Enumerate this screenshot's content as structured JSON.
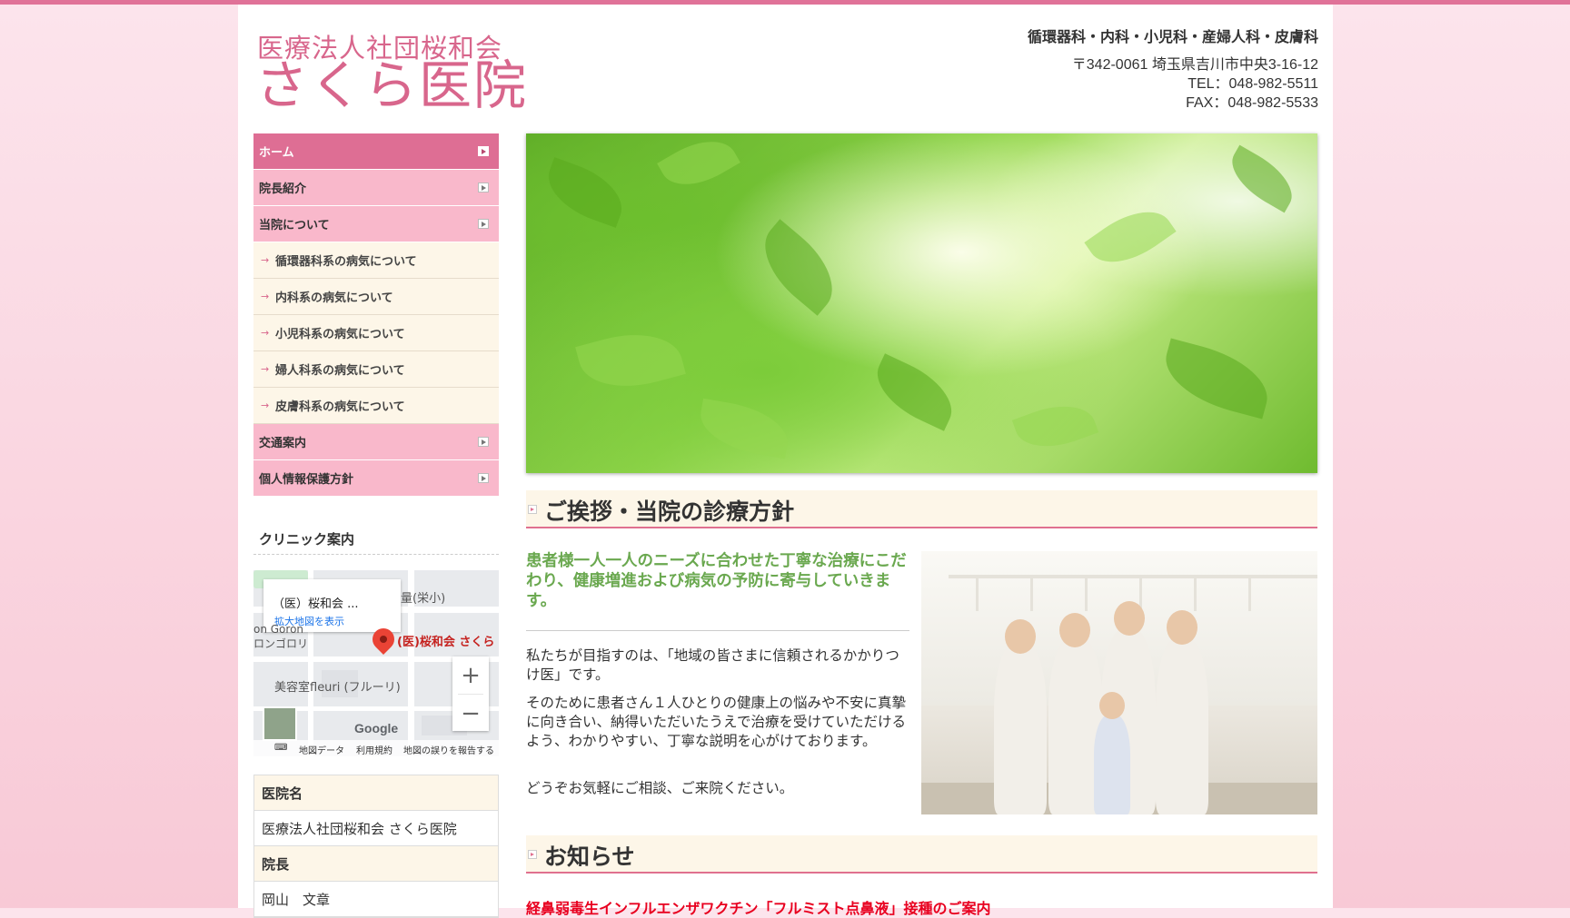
{
  "header": {
    "org_name": "医療法人社団桜和会",
    "clinic_name": "さくら医院",
    "specialties": "循環器科・内科・小児科・産婦人科・皮膚科",
    "address": "〒342-0061 埼玉県吉川市中央3-16-12",
    "tel": "TEL：048-982-5511",
    "fax": "FAX：048-982-5533"
  },
  "nav": {
    "items": [
      {
        "label": "ホーム"
      },
      {
        "label": "院長紹介"
      },
      {
        "label": "当院について"
      }
    ],
    "sub_items": [
      {
        "label": "循環器科系の病気について"
      },
      {
        "label": "内科系の病気について"
      },
      {
        "label": "小児科系の病気について"
      },
      {
        "label": "婦人科系の病気について"
      },
      {
        "label": "皮膚科系の病気について"
      }
    ],
    "items_after": [
      {
        "label": "交通案内"
      },
      {
        "label": "個人情報保護方針"
      }
    ]
  },
  "clinic_section": {
    "heading": "クリニック案内"
  },
  "map": {
    "card_title": "（医）桜和会 ...",
    "card_link": "拡大地図を表示",
    "label_school": "量(栄小)",
    "label_place1": "on Goron",
    "label_place2": "ロンゴロリ",
    "label_clinic": "(医)桜和会 さくら",
    "label_salon": "美容室fleuri (フルーリ)",
    "zoom_in": "+",
    "zoom_out": "−",
    "google": "Google",
    "footer_data": "地図データ",
    "footer_terms": "利用規約",
    "footer_report": "地図の誤りを報告する"
  },
  "info": {
    "rows": [
      {
        "th": "医院名",
        "td": "医療法人社団桜和会 さくら医院"
      },
      {
        "th": "院長",
        "td": "岡山　文章"
      }
    ]
  },
  "greeting": {
    "heading": "ご挨拶・当院の診療方針",
    "lead": "患者様一人一人のニーズに合わせた丁寧な治療にこだわり、健康増進および病気の予防に寄与していきます。",
    "p1": "私たちが目指すのは、「地域の皆さまに信頼されるかかりつけ医」です。",
    "p2": "そのために患者さん１人ひとりの健康上の悩みや不安に真摯に向き合い、納得いただいたうえで治療を受けていただけるよう、わかりやすい、丁寧な説明を心がけております。",
    "p3": "どうぞお気軽にご相談、ご来院ください。"
  },
  "news": {
    "heading": "お知らせ",
    "item1": "経鼻弱毒生インフルエンザワクチン「フルミスト点鼻液」接種のご案内"
  },
  "colors": {
    "accent": "#de6e94",
    "nav_bg": "#f9b8cb",
    "sub_bg": "#fdf6e8",
    "lead_green": "#6aa84f",
    "news_red": "#e8001f"
  }
}
